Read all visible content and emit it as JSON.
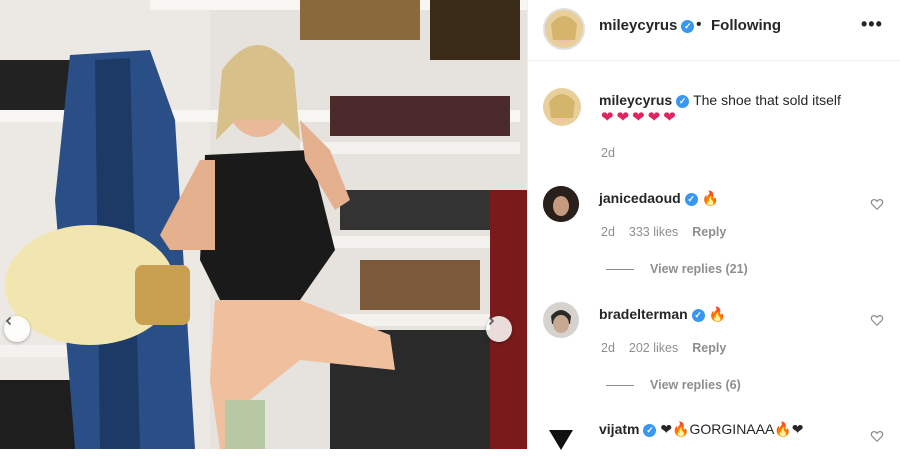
{
  "post": {
    "author": "mileycyrus",
    "follow_status": "Following",
    "more_glyph": "•••",
    "dot": "•",
    "caption_author": "mileycyrus",
    "caption_text": "The shoe that sold itself",
    "caption_emoji": "❤❤❤❤❤",
    "caption_time": "2d"
  },
  "comments": [
    {
      "user": "janicedaoud",
      "text": "🔥",
      "time": "2d",
      "likes": "333 likes",
      "reply": "Reply",
      "view_replies": "View replies (21)"
    },
    {
      "user": "bradelterman",
      "text": "🔥",
      "time": "2d",
      "likes": "202 likes",
      "reply": "Reply",
      "view_replies": "View replies (6)"
    },
    {
      "user": "vijatm",
      "text": "❤🔥GORGINAAA🔥❤"
    }
  ],
  "icons": {
    "verified": "verified-badge-icon",
    "heart": "heart-outline-icon",
    "prev": "chevron-left-icon",
    "next": "chevron-right-icon"
  },
  "colors": {
    "verified": "#3897f0",
    "text": "#262626",
    "muted": "#8e8e8e"
  }
}
